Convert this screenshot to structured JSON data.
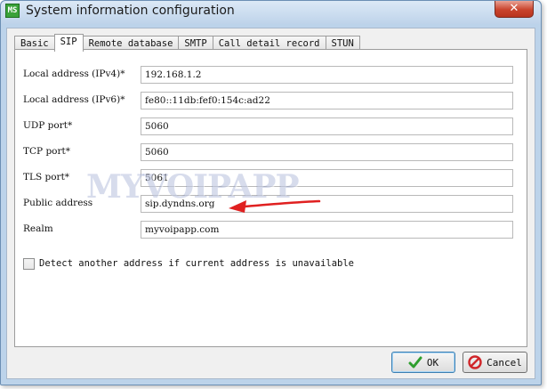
{
  "window": {
    "icon_text": "MS",
    "title": "System information configuration",
    "close_glyph": "✕"
  },
  "tabs": [
    {
      "label": "Basic",
      "active": false
    },
    {
      "label": "SIP",
      "active": true
    },
    {
      "label": "Remote database",
      "active": false
    },
    {
      "label": "SMTP",
      "active": false
    },
    {
      "label": "Call detail record",
      "active": false
    },
    {
      "label": "STUN",
      "active": false
    }
  ],
  "fields": {
    "ipv4": {
      "label": "Local address (IPv4)*",
      "value": "192.168.1.2"
    },
    "ipv6": {
      "label": "Local address (IPv6)*",
      "value": "fe80::11db:fef0:154c:ad22"
    },
    "udp": {
      "label": "UDP port*",
      "value": "5060"
    },
    "tcp": {
      "label": "TCP port*",
      "value": "5060"
    },
    "tls": {
      "label": "TLS port*",
      "value": "5061"
    },
    "public": {
      "label": "Public address",
      "value": "sip.dyndns.org"
    },
    "realm": {
      "label": "Realm",
      "value": "myvoipapp.com"
    }
  },
  "detect_checkbox": {
    "label": "Detect another address if current address is unavailable",
    "checked": false
  },
  "watermark": "MYVOIPAPP",
  "annotation": {
    "color": "#e02020",
    "icon": "red-arrow-icon"
  },
  "buttons": {
    "ok_label": "OK",
    "cancel_label": "Cancel"
  },
  "colors": {
    "ok_icon": "#2e9e2e",
    "cancel_icon": "#d0262a"
  }
}
